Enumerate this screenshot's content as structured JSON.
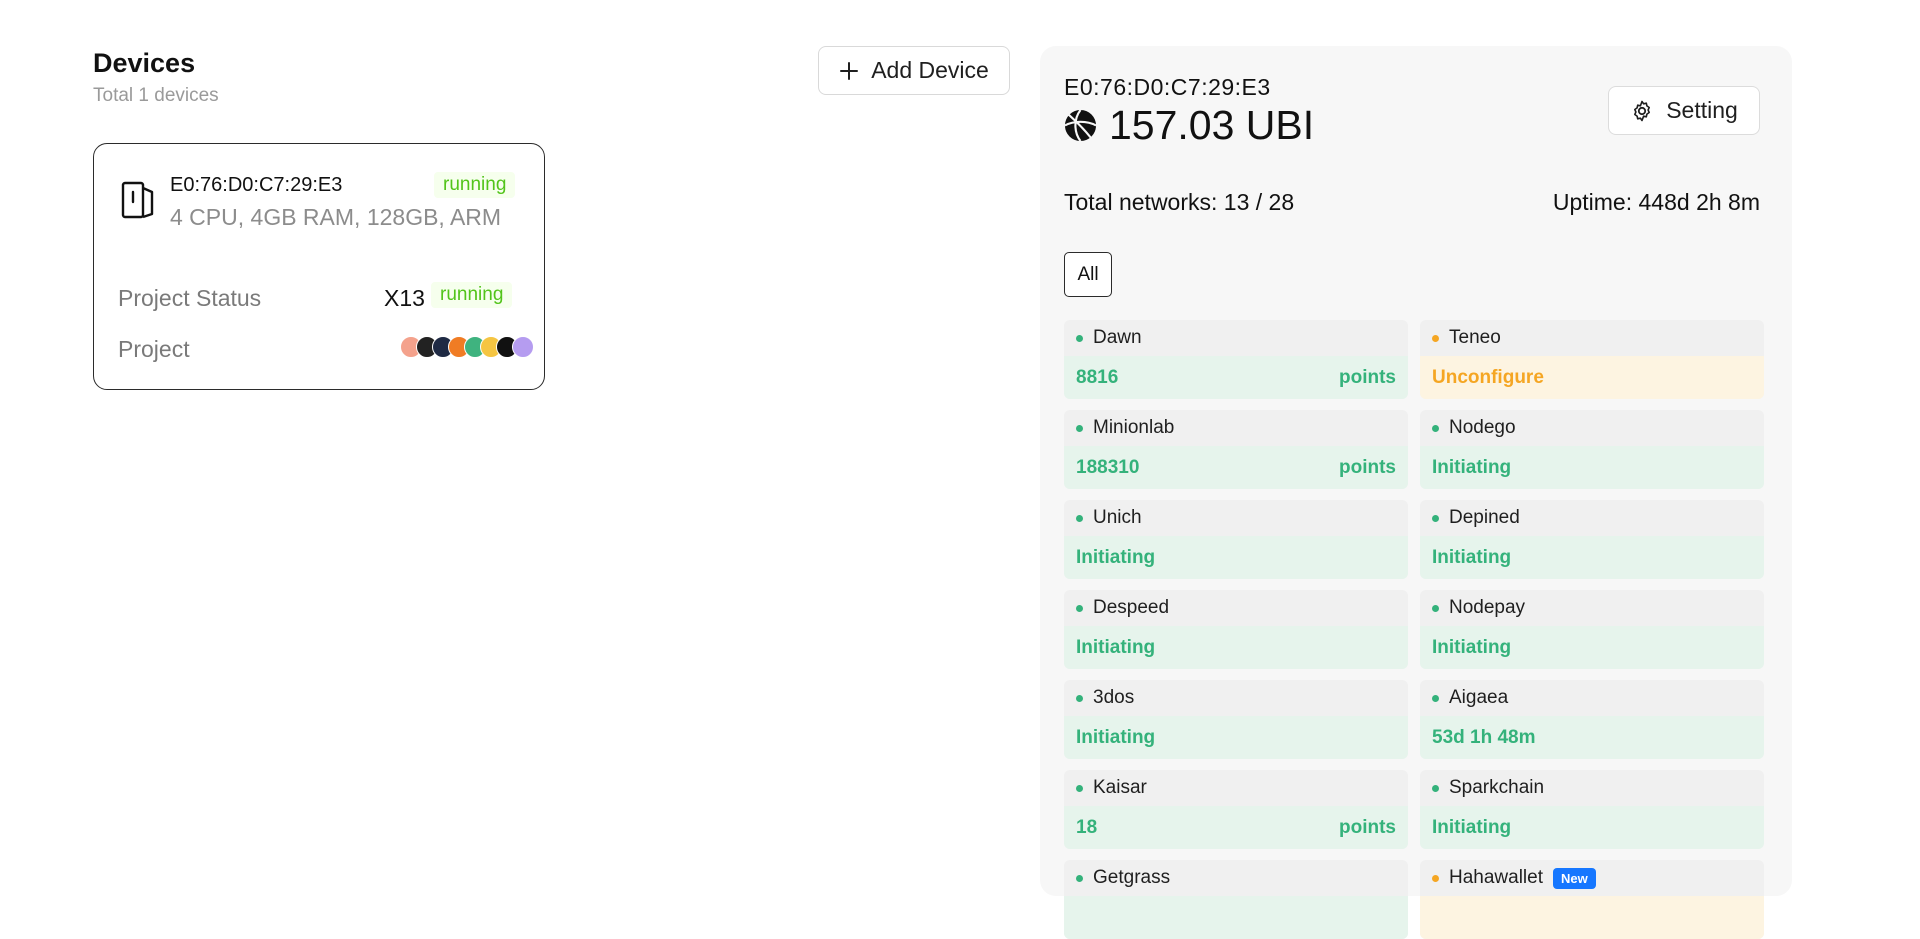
{
  "devices": {
    "title": "Devices",
    "subtitle": "Total 1 devices",
    "add_button_label": "Add Device"
  },
  "device_card": {
    "mac": "E0:76:D0:C7:29:E3",
    "status": "running",
    "specs": "4 CPU, 4GB RAM, 128GB, ARM",
    "project_status_label": "Project Status",
    "project_status_value": "X13",
    "project_status_badge": "running",
    "project_label": "Project",
    "project_icons": [
      "dawn-icon",
      "minionlab-icon",
      "unich-icon",
      "despeed-icon",
      "3dos-icon",
      "kaisar-icon",
      "getgrass-icon"
    ]
  },
  "panel": {
    "mac": "E0:76:D0:C7:29:E3",
    "balance": "157.03 UBI",
    "setting_label": "Setting",
    "total_networks": "Total networks: 13 / 28",
    "uptime": "Uptime: 448d 2h 8m",
    "filter_all": "All",
    "networks": [
      {
        "name": "Dawn",
        "value": "8816",
        "suffix": "points",
        "state": "green"
      },
      {
        "name": "Teneo",
        "value": "Unconfigure",
        "suffix": "",
        "state": "orange"
      },
      {
        "name": "Minionlab",
        "value": "188310",
        "suffix": "points",
        "state": "green"
      },
      {
        "name": "Nodego",
        "value": "Initiating",
        "suffix": "",
        "state": "green"
      },
      {
        "name": "Unich",
        "value": "Initiating",
        "suffix": "",
        "state": "green"
      },
      {
        "name": "Depined",
        "value": "Initiating",
        "suffix": "",
        "state": "green"
      },
      {
        "name": "Despeed",
        "value": "Initiating",
        "suffix": "",
        "state": "green"
      },
      {
        "name": "Nodepay",
        "value": "Initiating",
        "suffix": "",
        "state": "green"
      },
      {
        "name": "3dos",
        "value": "Initiating",
        "suffix": "",
        "state": "green"
      },
      {
        "name": "Aigaea",
        "value": "53d 1h 48m",
        "suffix": "",
        "state": "green"
      },
      {
        "name": "Kaisar",
        "value": "18",
        "suffix": "points",
        "state": "green"
      },
      {
        "name": "Sparkchain",
        "value": "Initiating",
        "suffix": "",
        "state": "green"
      },
      {
        "name": "Getgrass",
        "value": "",
        "suffix": "",
        "state": "green"
      },
      {
        "name": "Hahawallet",
        "value": "",
        "suffix": "",
        "state": "orange",
        "badge": "New"
      }
    ]
  },
  "colors": {
    "green_dot": "#34b27b",
    "orange_dot": "#f5a623",
    "running_text": "#52c41a",
    "new_badge": "#1677ff"
  }
}
